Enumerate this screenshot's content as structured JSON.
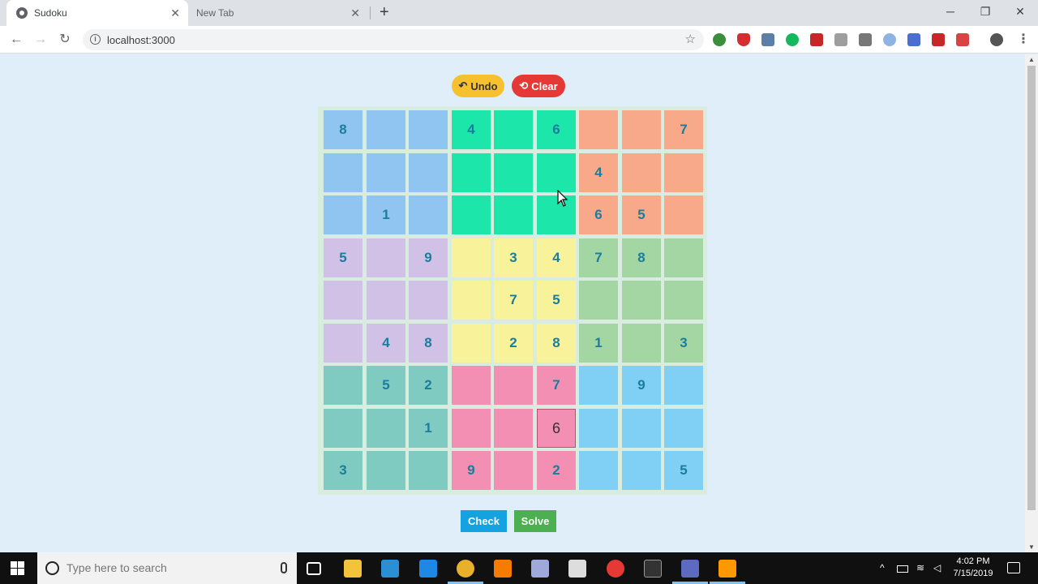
{
  "browser": {
    "tabs": [
      {
        "label": "Sudoku",
        "active": true
      },
      {
        "label": "New Tab",
        "active": false
      }
    ],
    "new_tab_label": "+",
    "url": "localhost:3000",
    "window_controls": {
      "minimize": "─",
      "restore": "❐",
      "close": "✕"
    }
  },
  "app": {
    "undo_label": "Undo",
    "undo_icon": "↶",
    "clear_label": "Clear",
    "clear_icon": "⟲",
    "check_label": "Check",
    "solve_label": "Solve",
    "colors": {
      "undo": "#f7c12e",
      "clear": "#e53935",
      "check": "#14a2e0",
      "solve": "#4caf50",
      "digit": "#1b7d9b"
    },
    "block_colors": [
      [
        "#90c5f2",
        "#1ce6aa",
        "#f7a98a"
      ],
      [
        "#d2c1e6",
        "#f8f29a",
        "#a3d6a3"
      ],
      [
        "#7fcbc1",
        "#f38fb3",
        "#80cff5"
      ]
    ],
    "editing_cell": {
      "row": 7,
      "col": 5
    },
    "grid": [
      [
        "8",
        "",
        "",
        "4",
        "",
        "6",
        "",
        "",
        "7"
      ],
      [
        "",
        "",
        "",
        "",
        "",
        "",
        "4",
        "",
        ""
      ],
      [
        "",
        "1",
        "",
        "",
        "",
        "",
        "6",
        "5",
        ""
      ],
      [
        "5",
        "",
        "9",
        "",
        "3",
        "4",
        "7",
        "8",
        ""
      ],
      [
        "",
        "",
        "",
        "",
        "7",
        "5",
        "",
        "",
        ""
      ],
      [
        "",
        "4",
        "8",
        "",
        "2",
        "8",
        "1",
        "",
        "3"
      ],
      [
        "",
        "5",
        "2",
        "",
        "",
        "7",
        "",
        "9",
        ""
      ],
      [
        "",
        "",
        "1",
        "",
        "",
        "6",
        "",
        "",
        ""
      ],
      [
        "3",
        "",
        "",
        "9",
        "",
        "2",
        "",
        "",
        "5"
      ]
    ]
  },
  "taskbar": {
    "search_placeholder": "Type here to search",
    "time": "4:02 PM",
    "date": "7/15/2019",
    "apps": [
      "task-view-icon",
      "file-explorer-icon",
      "vscode-icon",
      "edge-icon",
      "chrome-icon",
      "firefox-icon",
      "git-icon",
      "inkscape-icon",
      "opera-icon",
      "terminal-icon",
      "visual-studio-icon",
      "sublime-icon"
    ]
  }
}
